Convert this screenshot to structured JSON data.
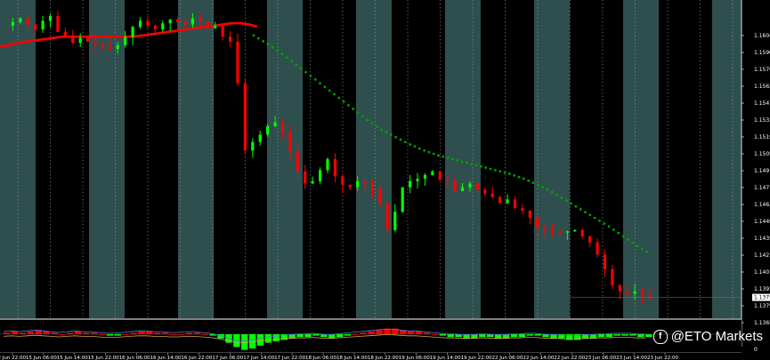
{
  "chart_data": {
    "type": "candlestick",
    "symbol_window": "price chart with moving averages and histogram oscillator",
    "colors": {
      "background": "#000000",
      "band": "#2f4f4f",
      "bull": "#00ff00",
      "bear": "#ff0000",
      "ma_fast": "#ff0000",
      "ma_slow": "#00a000",
      "price_tag_bg": "#ffffff",
      "hist_pos": "#ff0000",
      "hist_neg": "#00ff00"
    },
    "y_ticks": [
      "1.1604",
      "1.1590",
      "1.1576",
      "1.1562",
      "1.1547",
      "1.1533",
      "1.1519",
      "1.1505",
      "1.1491",
      "1.1477",
      "1.1463",
      "1.1449",
      "1.1435",
      "1.1421",
      "1.1407",
      "1.1393",
      "1.1379",
      "1.1365"
    ],
    "current_price": "1.1375",
    "sub_ticks": [
      "0"
    ],
    "time_labels": [
      "12 Jun 22:00",
      "15 Jun 06:00",
      "15 Jun 14:00",
      "15 Jun 22:00",
      "16 Jun 06:00",
      "16 Jun 14:00",
      "16 Jun 22:00",
      "17 Jun 06:00",
      "17 Jun 14:00",
      "17 Jun 22:00",
      "18 Jun 06:00",
      "18 Jun 14:00",
      "18 Jun 22:00",
      "19 Jun 06:00",
      "19 Jun 14:00",
      "19 Jun 22:00",
      "22 Jun 06:00",
      "22 Jun 14:00",
      "22 Jun 22:00",
      "23 Jun 06:00",
      "23 Jun 14:00",
      "23 Jun 22:00"
    ],
    "price_path": [
      1.1597,
      1.16,
      1.1603,
      1.1598,
      1.1594,
      1.1601,
      1.1605,
      1.1592,
      1.1589,
      1.1583,
      1.1587,
      1.1584,
      1.1582,
      1.158,
      1.1578,
      1.1581,
      1.1588,
      1.1596,
      1.1601,
      1.1597,
      1.1594,
      1.1599,
      1.1602,
      1.16,
      1.1598,
      1.1603,
      1.16,
      1.1595,
      1.1597,
      1.1588,
      1.1584,
      1.155,
      1.1495,
      1.1502,
      1.1508,
      1.1515,
      1.1518,
      1.151,
      1.1494,
      1.1478,
      1.1468,
      1.147,
      1.1479,
      1.1488,
      1.1474,
      1.1467,
      1.1465,
      1.147,
      1.1468,
      1.1463,
      1.1452,
      1.143,
      1.1445,
      1.1465,
      1.147,
      1.1472,
      1.1475,
      1.1478,
      1.1471,
      1.147,
      1.1462,
      1.1465,
      1.1468,
      1.1463,
      1.146,
      1.1457,
      1.1452,
      1.1455,
      1.1448,
      1.1446,
      1.144,
      1.1432,
      1.143,
      1.1429,
      1.1428,
      1.1429,
      1.143,
      1.1425,
      1.142,
      1.141,
      1.1398,
      1.1385,
      1.138,
      1.1378,
      1.138,
      1.1377,
      1.1375
    ],
    "ma_fast": [
      1.158,
      1.1581,
      1.1583,
      1.1584,
      1.1585,
      1.1586,
      1.1587,
      1.1588,
      1.1588,
      1.1588,
      1.1588,
      1.1588,
      1.1588,
      1.1588,
      1.1588,
      1.1588,
      1.1589,
      1.159,
      1.1591,
      1.1592,
      1.1593,
      1.1594,
      1.1595,
      1.1596,
      1.1597,
      1.1598,
      1.1599,
      1.1599,
      1.1598,
      1.1596
    ],
    "ma_slow": [
      1.1589,
      1.1582,
      1.1574,
      1.1565,
      1.1556,
      1.1547,
      1.1538,
      1.1529,
      1.152,
      1.1512,
      1.1506,
      1.15,
      1.1495,
      1.1491,
      1.1488,
      1.1485,
      1.1482,
      1.1479,
      1.1476,
      1.1472,
      1.1467,
      1.1461,
      1.1454,
      1.1447,
      1.144,
      1.1433,
      1.1425,
      1.1417,
      1.141
    ],
    "y_range": [
      1.1358,
      1.1618
    ],
    "hist": [
      1,
      2,
      1,
      2,
      3,
      2,
      1,
      0,
      1,
      2,
      1,
      1,
      0,
      -1,
      -1,
      0,
      1,
      2,
      2,
      1,
      1,
      0,
      0,
      1,
      1,
      0,
      -1,
      -3,
      -6,
      -9,
      -11,
      -10,
      -8,
      -6,
      -5,
      -4,
      -3,
      -2,
      -2,
      -1,
      -2,
      -3,
      -2,
      -1,
      0,
      1,
      2,
      3,
      4,
      4,
      3,
      2,
      2,
      1,
      0,
      -1,
      -2,
      -2,
      -3,
      -3,
      -2,
      -2,
      -3,
      -3,
      -2,
      -2,
      -1,
      -1,
      -2,
      -3,
      -3,
      -4,
      -4,
      -3,
      -3,
      -2,
      -2,
      -1,
      -1,
      -1,
      -2,
      -2
    ]
  },
  "watermark": {
    "icon": "facebook-icon",
    "text": "@ETO Markets"
  }
}
